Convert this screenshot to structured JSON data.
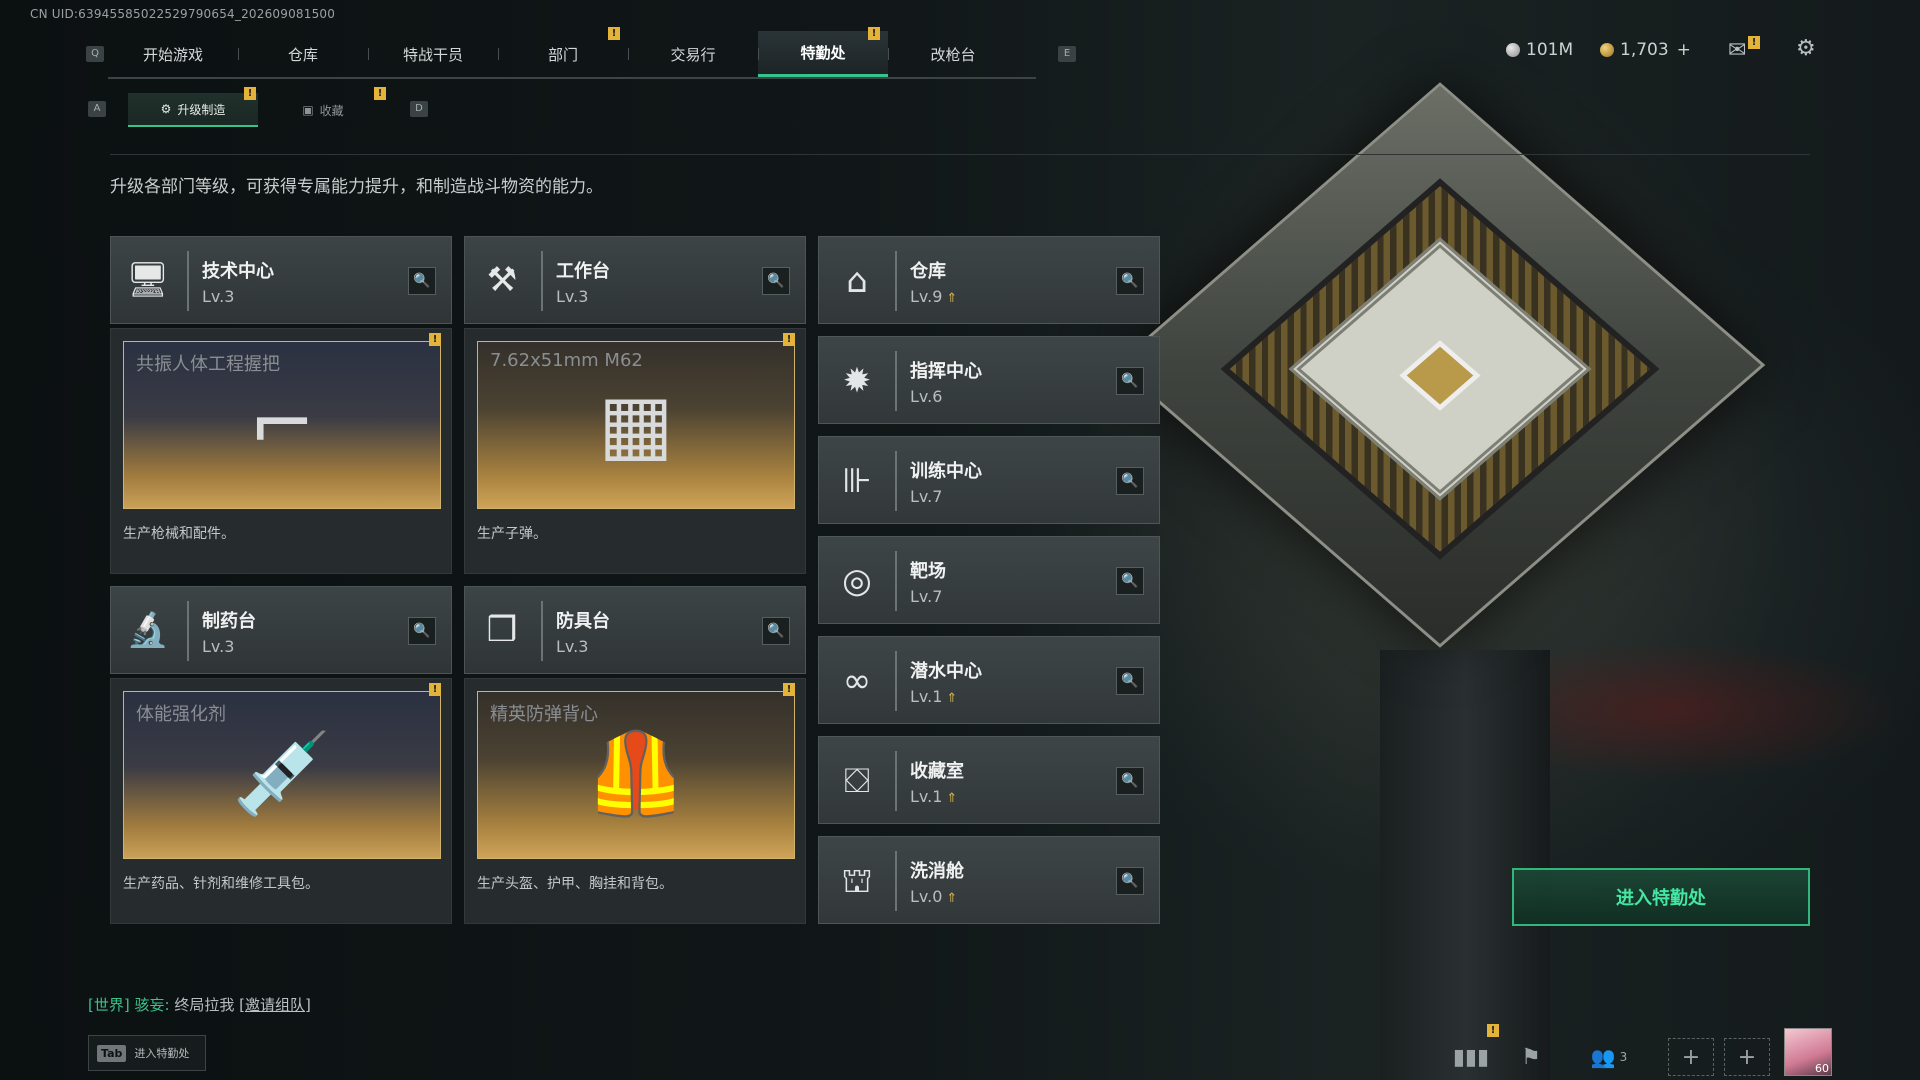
{
  "uid_text": "CN UID:6394558502252979065​4_202609081500",
  "nav": {
    "key_left": "Q",
    "key_right": "E",
    "tabs": [
      {
        "label": "开始游戏",
        "active": false,
        "badge": false
      },
      {
        "label": "仓库",
        "active": false,
        "badge": false
      },
      {
        "label": "特战干员",
        "active": false,
        "badge": false
      },
      {
        "label": "部门",
        "active": false,
        "badge": true
      },
      {
        "label": "交易行",
        "active": false,
        "badge": false
      },
      {
        "label": "特勤处",
        "active": true,
        "badge": true
      },
      {
        "label": "改枪台",
        "active": false,
        "badge": false
      }
    ]
  },
  "currency": {
    "silver": "101M",
    "gold": "1,703",
    "gold_add": "+"
  },
  "subtabs": {
    "key_left": "A",
    "key_right": "D",
    "items": [
      {
        "label": "升级制造",
        "active": true,
        "badge": "!"
      },
      {
        "label": "收藏",
        "active": false,
        "badge": "!"
      }
    ]
  },
  "description": "升级各部门等级，可获得专属能力提升，和制造战斗物资的能力。",
  "badge_mark": "!",
  "production_cards": [
    {
      "name": "技术中心",
      "level": "Lv.3",
      "icon": "monitor-icon",
      "item_title": "共振人体工程握把",
      "item_icon": "grip-icon",
      "note": "生产枪械和配件。"
    },
    {
      "name": "工作台",
      "level": "Lv.3",
      "icon": "hammer-wrench-icon",
      "item_title": "7.62x51mm M62",
      "item_icon": "ammo-box-icon",
      "note": "生产子弹。"
    },
    {
      "name": "制药台",
      "level": "Lv.3",
      "icon": "microscope-icon",
      "item_title": "体能强化剂",
      "item_icon": "syringe-icon",
      "note": "生产药品、针剂和维修工具包。"
    },
    {
      "name": "防具台",
      "level": "Lv.3",
      "icon": "cubes-icon",
      "item_title": "精英防弹背心",
      "item_icon": "vest-icon",
      "note": "生产头盔、护甲、胸挂和背包。"
    }
  ],
  "departments": [
    {
      "name": "仓库",
      "level": "Lv.9",
      "upgradable": true,
      "icon": "warehouse-icon"
    },
    {
      "name": "指挥中心",
      "level": "Lv.6",
      "upgradable": false,
      "icon": "command-icon"
    },
    {
      "name": "训练中心",
      "level": "Lv.7",
      "upgradable": false,
      "icon": "dumbbell-icon"
    },
    {
      "name": "靶场",
      "level": "Lv.7",
      "upgradable": false,
      "icon": "target-icon"
    },
    {
      "name": "潜水中心",
      "level": "Lv.1",
      "upgradable": true,
      "icon": "goggles-icon"
    },
    {
      "name": "收藏室",
      "level": "Lv.1",
      "upgradable": true,
      "icon": "display-case-icon"
    },
    {
      "name": "洗消舱",
      "level": "Lv.0",
      "upgradable": true,
      "icon": "decon-chamber-icon"
    }
  ],
  "enter_button": "进入特勤处",
  "chat": {
    "channel": "[世界]",
    "sender": "骇妄:",
    "message": "终局拉我",
    "invite": "[邀请组队]"
  },
  "tab_hint": {
    "key": "Tab",
    "label": "进入特勤处"
  },
  "friends_count": "3",
  "player_level": "60",
  "colors": {
    "accent": "#35c48c",
    "badge": "#e4b43a",
    "enter_text": "#45e6a2"
  }
}
